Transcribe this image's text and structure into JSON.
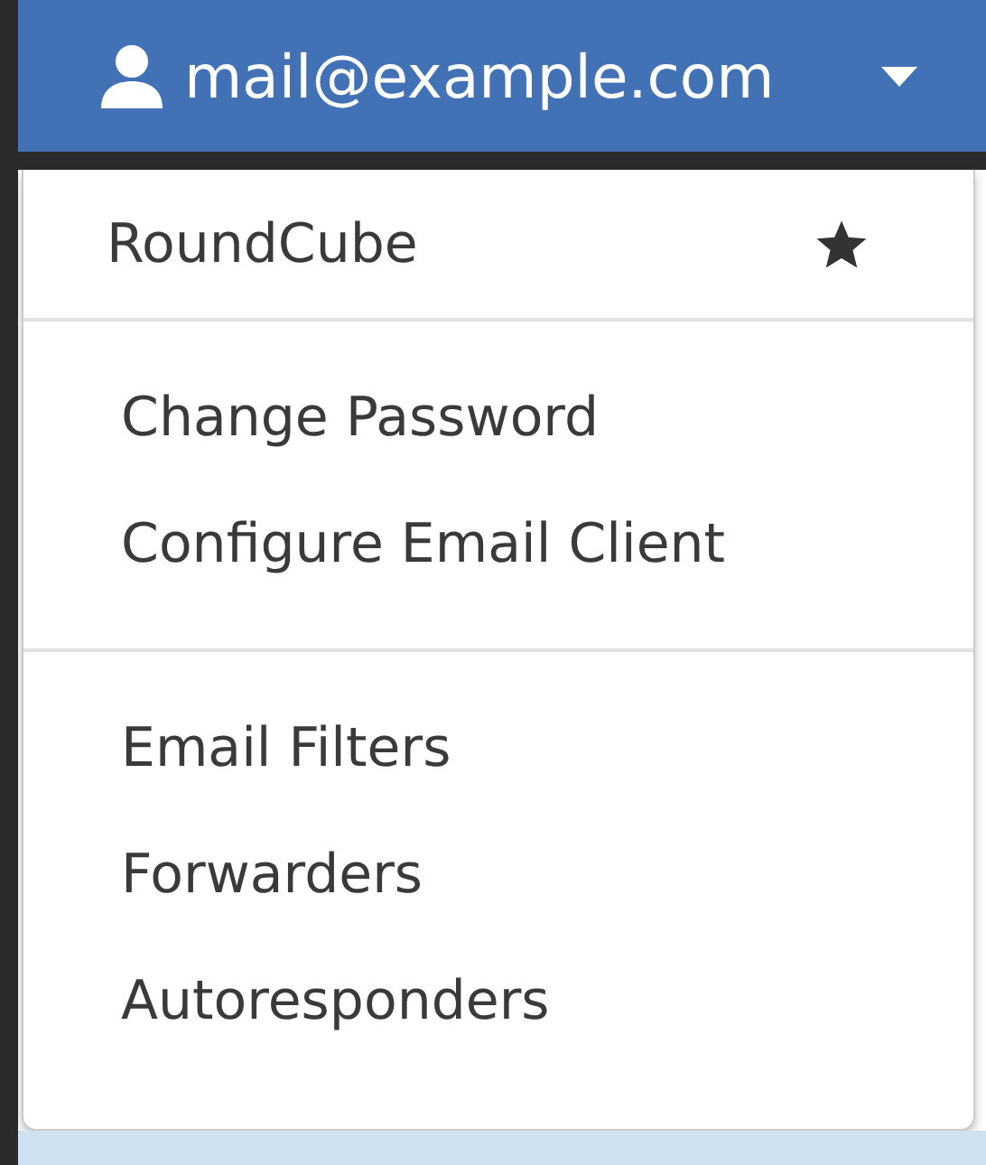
{
  "account_button": {
    "label": "mail@example.com"
  },
  "menu": {
    "groups": [
      {
        "items": [
          {
            "label": "RoundCube",
            "kind": "favorite"
          }
        ]
      },
      {
        "items": [
          {
            "label": "Change Password",
            "kind": "link"
          },
          {
            "label": "Configure Email Client",
            "kind": "link"
          }
        ]
      },
      {
        "items": [
          {
            "label": "Email Filters",
            "kind": "link"
          },
          {
            "label": "Forwarders",
            "kind": "link"
          },
          {
            "label": "Autoresponders",
            "kind": "link"
          }
        ]
      }
    ]
  }
}
